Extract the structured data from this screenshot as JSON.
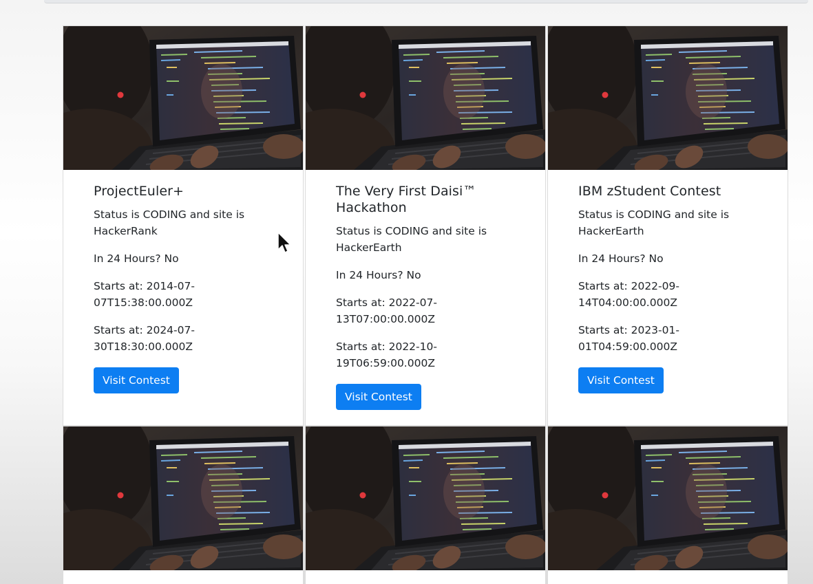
{
  "contests": [
    {
      "title": "ProjectEuler+",
      "status_text": "Status is CODING and site is HackerRank",
      "in24": "In 24 Hours? No",
      "start": "Starts at: 2014-07-07T15:38:00.000Z",
      "end": "Starts at: 2024-07-30T18:30:00.000Z",
      "button_label": "Visit Contest"
    },
    {
      "title": "The Very First Daisi™ Hackathon",
      "status_text": "Status is CODING and site is HackerEarth",
      "in24": "In 24 Hours? No",
      "start": "Starts at: 2022-07-13T07:00:00.000Z",
      "end": "Starts at: 2022-10-19T06:59:00.000Z",
      "button_label": "Visit Contest"
    },
    {
      "title": "IBM zStudent Contest",
      "status_text": "Status is CODING and site is HackerEarth",
      "in24": "In 24 Hours? No",
      "start": "Starts at: 2022-09-14T04:00:00.000Z",
      "end": "Starts at: 2023-01-01T04:59:00.000Z",
      "button_label": "Visit Contest"
    }
  ],
  "colors": {
    "button": "#0d7ef2",
    "text": "#212529",
    "card_border": "#dcdcdc"
  },
  "icons": {
    "card_image": "person-coding-on-laptop-photo",
    "cursor": "mouse-pointer-icon"
  }
}
